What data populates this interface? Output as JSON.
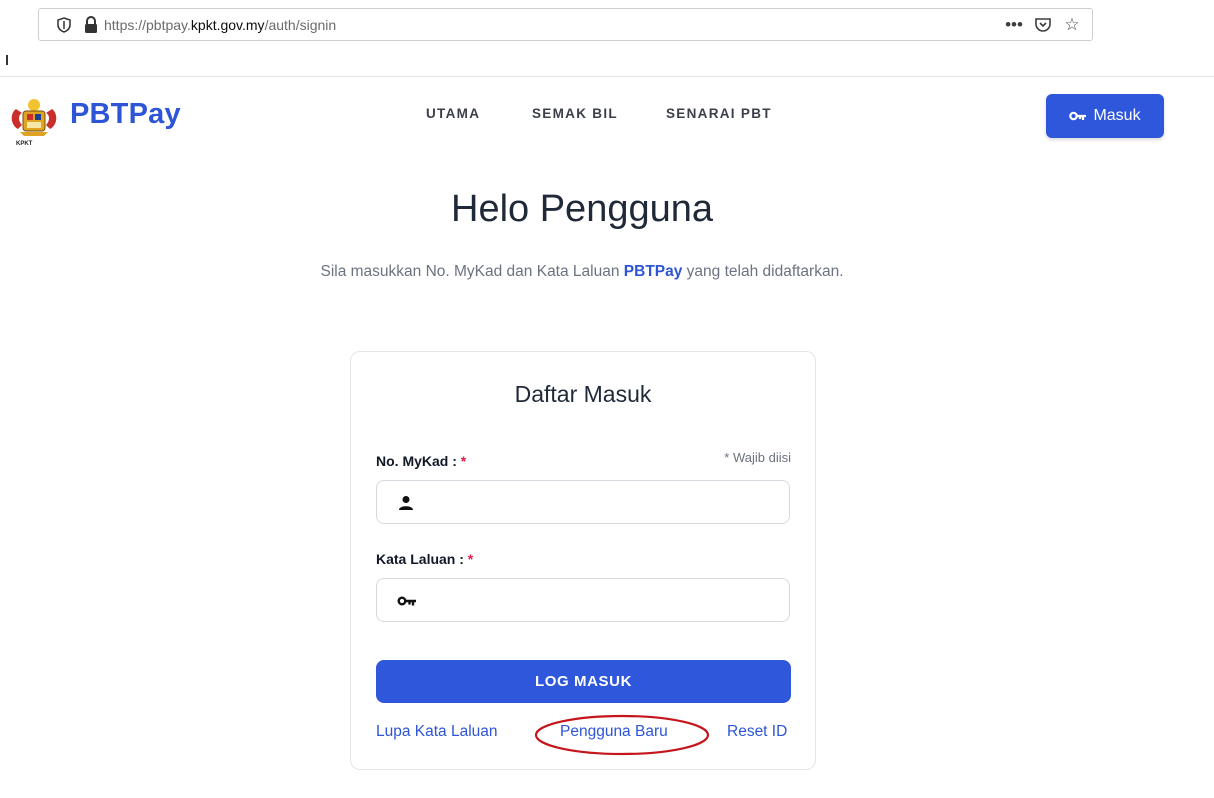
{
  "browser": {
    "url_prefix": "https://pbtpay.",
    "url_domain": "kpkt.gov.my",
    "url_path": "/auth/signin",
    "actions": [
      "more-icon",
      "pocket-icon",
      "bookmark-star-icon"
    ]
  },
  "nav": {
    "brand": "PBTPay",
    "logo_caption": "KPKT",
    "links": [
      "UTAMA",
      "SEMAK BIL",
      "SENARAI PBT"
    ],
    "login_button": "Masuk"
  },
  "hero": {
    "title": "Helo Pengguna",
    "subtitle_before": "Sila masukkan No. MyKad dan Kata Laluan ",
    "subtitle_brand": "PBTPay",
    "subtitle_after": " yang telah didaftarkan."
  },
  "form": {
    "title": "Daftar Masuk",
    "mykad_label": "No. MyKad :",
    "password_label": "Kata Laluan :",
    "required_marker": "*",
    "required_note": "* Wajib diisi",
    "mykad_value": "",
    "password_value": "",
    "submit": "LOG MASUK",
    "forgot_link": "Lupa Kata Laluan",
    "new_user_link": "Pengguna Baru",
    "reset_link": "Reset ID"
  },
  "colors": {
    "accent": "#2f57db",
    "highlight_ellipse": "#c4161c",
    "required": "#e11d48"
  }
}
